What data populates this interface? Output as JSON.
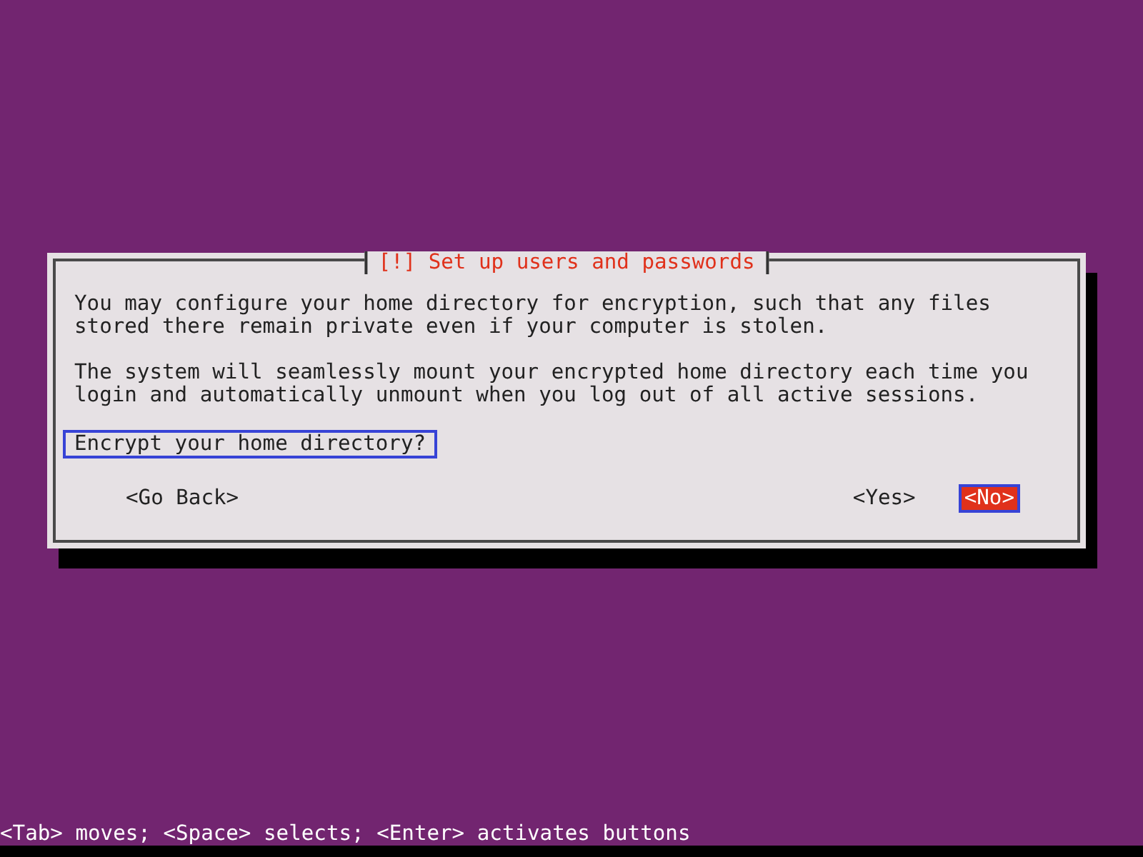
{
  "dialog": {
    "title": "[!] Set up users and passwords",
    "paragraphs": [
      "You may configure your home directory for encryption, such that any files stored there remain private even if your computer is stolen.",
      "The system will seamlessly mount your encrypted home directory each time you login and automatically unmount when you log out of all active sessions."
    ],
    "question": {
      "text": "Encrypt your home directory?",
      "focused": true
    },
    "buttons": [
      {
        "label": "<Go Back>",
        "selected": false
      },
      {
        "label": "<Yes>",
        "selected": false
      },
      {
        "label": "<No>",
        "selected": true
      }
    ]
  },
  "status_bar": "<Tab> moves; <Space> selects; <Enter> activates buttons"
}
